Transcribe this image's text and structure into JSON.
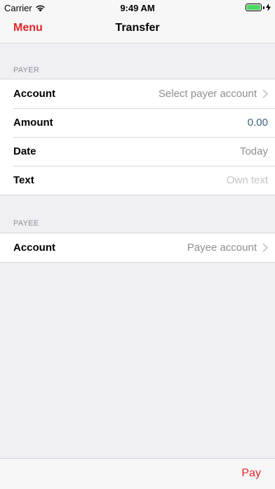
{
  "status_bar": {
    "carrier": "Carrier",
    "time": "9:49 AM",
    "battery_icon": "battery-icon",
    "wifi_icon": "wifi-icon",
    "charging_icon": "charging-bolt-icon"
  },
  "nav": {
    "menu_label": "Menu",
    "title": "Transfer"
  },
  "payer": {
    "header": "PAYER",
    "rows": [
      {
        "label": "Account",
        "value": "Select payer account",
        "has_chevron": true
      },
      {
        "label": "Amount",
        "value": "0.00",
        "has_chevron": false
      },
      {
        "label": "Date",
        "value": "Today",
        "has_chevron": false
      },
      {
        "label": "Text",
        "value": "Own text",
        "has_chevron": false
      }
    ]
  },
  "payee": {
    "header": "PAYEE",
    "rows": [
      {
        "label": "Account",
        "value": "Payee account",
        "has_chevron": true
      }
    ]
  },
  "toolbar": {
    "pay_label": "Pay"
  },
  "colors": {
    "accent": "#e0252b",
    "amount": "#3b5f7e",
    "battery": "#4cd964"
  }
}
